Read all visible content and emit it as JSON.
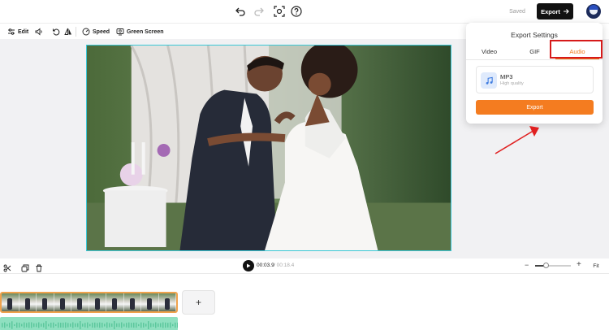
{
  "header": {
    "saved_label": "Saved",
    "export_label": "Export"
  },
  "toolbar": {
    "edit_label": "Edit",
    "speed_label": "Speed",
    "green_screen_label": "Green Screen"
  },
  "export_panel": {
    "title": "Export Settings",
    "tabs": [
      {
        "label": "Video",
        "active": false
      },
      {
        "label": "GIF",
        "active": false
      },
      {
        "label": "Audio",
        "active": true
      }
    ],
    "format": {
      "name": "MP3",
      "quality": "High quality",
      "icon": "music-note-icon"
    },
    "export_button": "Export"
  },
  "timeline": {
    "current_time": "00:03.9",
    "total_time": " / 00:18.4",
    "fit_label": "Fit",
    "zoom_level": 0.3,
    "add_clip_label": "+"
  },
  "colors": {
    "accent": "#f47c20",
    "highlight_box": "#d61a1a",
    "selection_border": "#39c7d6",
    "video_track_border": "#f0a24c",
    "audio_track": "#8fe0c0"
  }
}
